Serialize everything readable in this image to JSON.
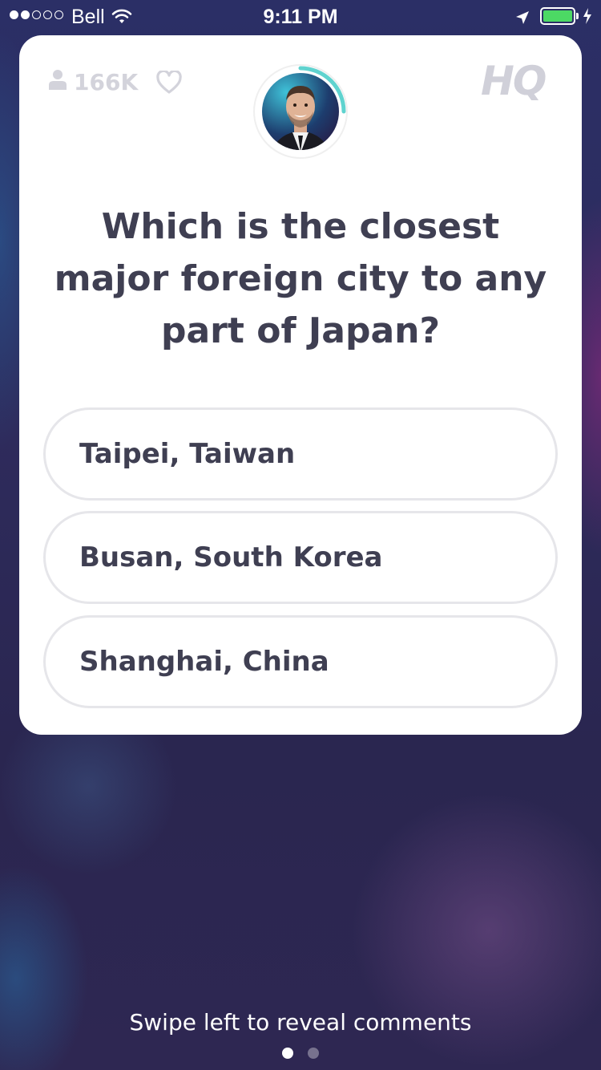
{
  "status_bar": {
    "carrier": "Bell",
    "time": "9:11 PM",
    "signal_strength_dots": 2,
    "signal_total_dots": 5,
    "battery_level": 1.0,
    "battery_color": "#4cd964",
    "icons": [
      "wifi-icon",
      "location-icon",
      "battery-icon",
      "charging-icon"
    ]
  },
  "card": {
    "viewer_count": "166K",
    "logo": "HQ",
    "host_timer_color": "#5fd3cf",
    "question": "Which is the closest major foreign city to any part of Japan?",
    "answers": [
      {
        "label": "Taipei, Taiwan"
      },
      {
        "label": "Busan, South Korea"
      },
      {
        "label": "Shanghai, China"
      }
    ]
  },
  "footer": {
    "swipe_hint": "Swipe left to reveal comments",
    "page_count": 2,
    "active_page": 1
  }
}
